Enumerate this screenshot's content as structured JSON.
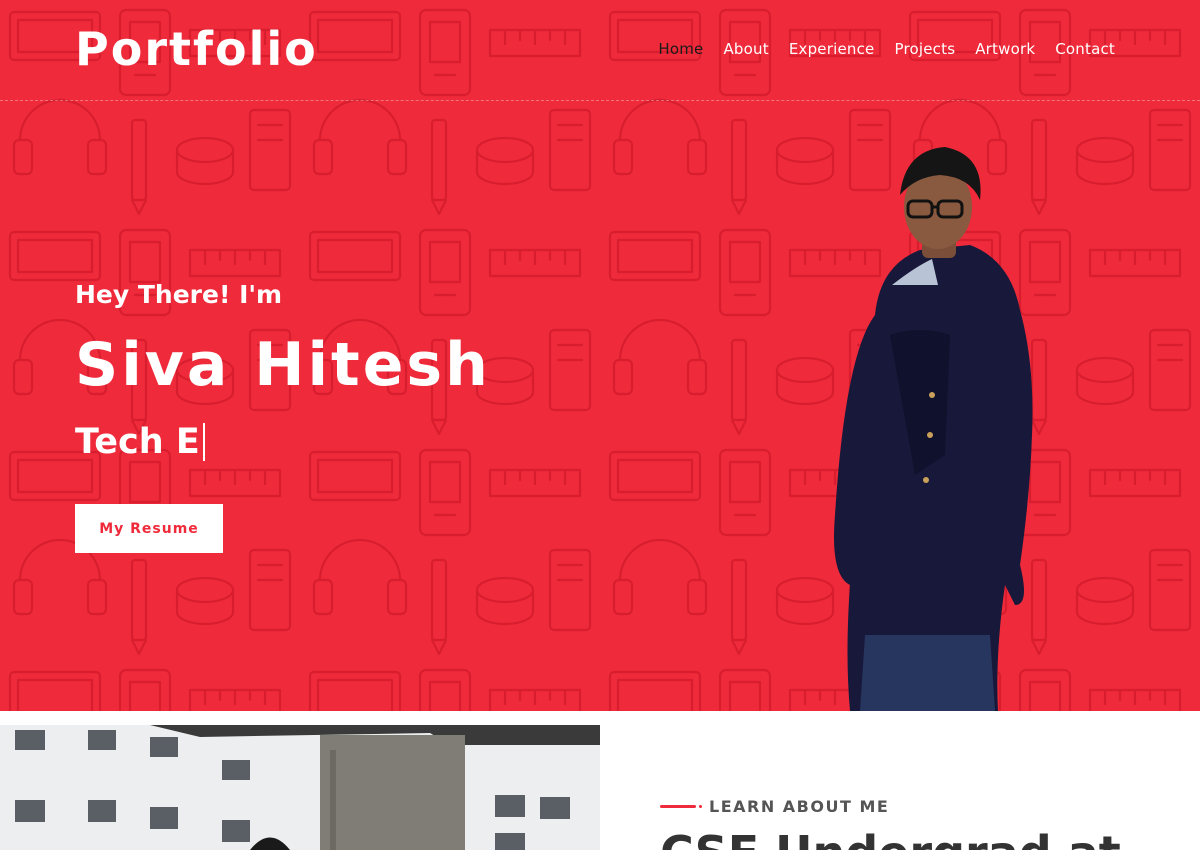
{
  "navbar": {
    "brand": "Portfolio",
    "links": [
      {
        "label": "Home",
        "active": true
      },
      {
        "label": "About",
        "active": false
      },
      {
        "label": "Experience",
        "active": false
      },
      {
        "label": "Projects",
        "active": false
      },
      {
        "label": "Artwork",
        "active": false
      },
      {
        "label": "Contact",
        "active": false
      }
    ]
  },
  "hero": {
    "greeting": "Hey There! I'm",
    "name": "Siva Hitesh",
    "typed_role": "Tech E",
    "resume_button": "My Resume",
    "background_color": "#ef2a3a"
  },
  "about": {
    "eyebrow": "LEARN ABOUT ME",
    "heading": "CSE Undergrad at"
  },
  "colors": {
    "accent": "#ef2a3a",
    "nav_active": "#1b1b1b",
    "text_light": "#ffffff"
  }
}
